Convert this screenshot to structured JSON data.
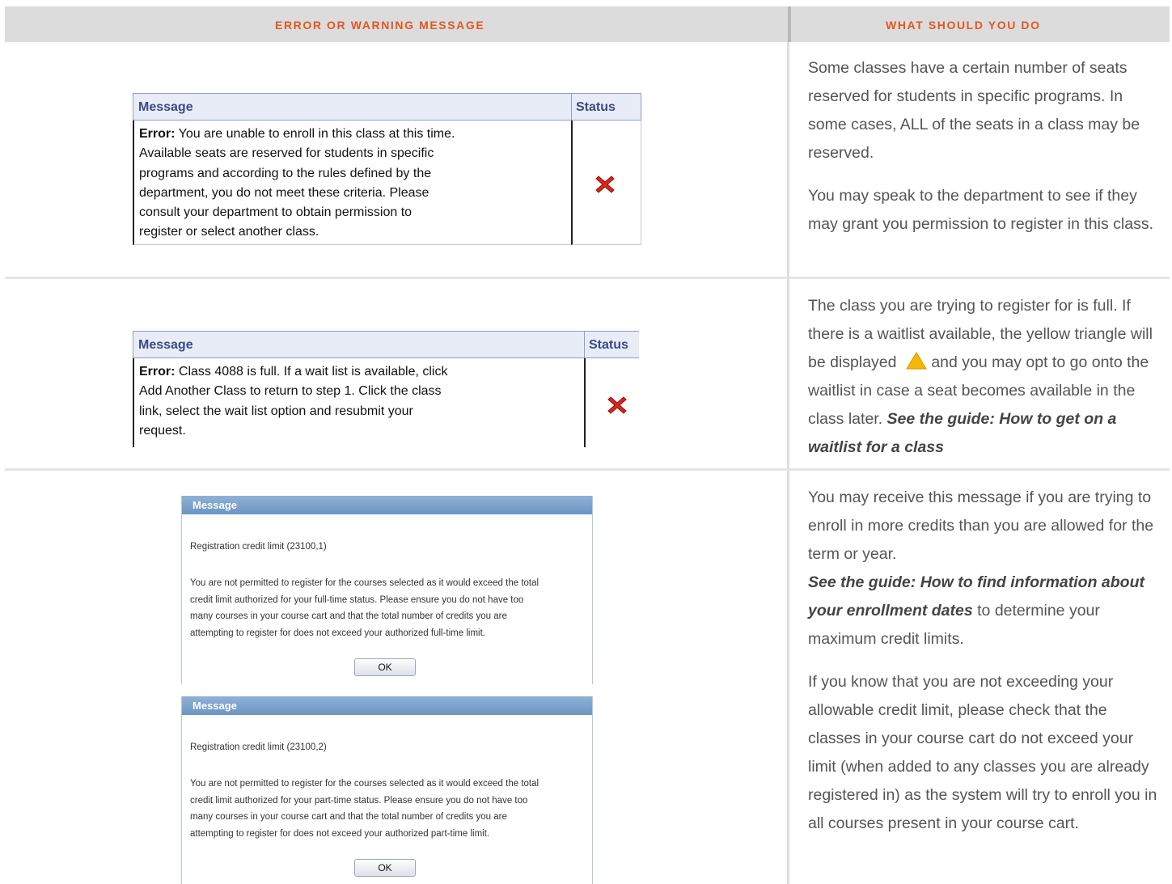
{
  "header": {
    "left_label": "ERROR OR WARNING MESSAGE",
    "right_label": "WHAT SHOULD YOU DO"
  },
  "rows": [
    {
      "table": {
        "col_message": "Message",
        "col_status": "Status",
        "error_label": "Error:",
        "error_lines": [
          " You are unable to enroll in this class at this time.",
          "Available seats are reserved for students in specific",
          "programs and according to the rules defined by the",
          "department, you do not meet these criteria. Please",
          "consult your department to obtain permission to",
          "register or select another class."
        ],
        "status_icon": "red-x-icon"
      },
      "advice": {
        "p1": "Some classes have a certain number of seats reserved for students in specific programs. In some cases, ALL of the seats in a class may be reserved.",
        "p2": "You may speak to the department to see if they may grant you permission to register in this class."
      }
    },
    {
      "table": {
        "col_message": "Message",
        "col_status": "Status",
        "error_label": "Error:",
        "error_lines": [
          " Class 4088 is full. If a wait list is available, click",
          "Add Another Class to return to step 1. Click the class",
          "link, select the wait list option and resubmit your",
          "request."
        ],
        "status_icon": "red-x-icon"
      },
      "advice": {
        "p1_a": "The class you are trying to register for is full. If there is a waitlist available, the yellow triangle will be displayed",
        "p1_b": " and you may opt to go onto the waitlist in case a seat becomes available in the class later. ",
        "p1_link": "See the guide: How to get on a waitlist for a class",
        "icon": "yellow-triangle-icon"
      }
    },
    {
      "dialogs": [
        {
          "title": "Message",
          "code": "Registration credit limit (23100,1)",
          "lines": [
            "You are not permitted to register for the courses selected as it would exceed the total",
            "credit limit authorized for your full-time status. Please ensure you do not have too",
            "many courses in your course  cart and that the total number of credits you are",
            "attempting to register for does not exceed your authorized full-time limit."
          ],
          "ok": "OK"
        },
        {
          "title": "Message",
          "code": "Registration credit limit (23100,2)",
          "lines": [
            "You are not permitted to register for the courses selected as it would exceed the total",
            "credit limit authorized for your part-time status. Please ensure you do not have too",
            "many courses in your course cart and that the total number of credits you are",
            "attempting to register for does not exceed your authorized part-time limit."
          ],
          "ok": "OK"
        }
      ],
      "advice": {
        "p1": "You may receive this message if you are trying to enroll in more credits than you are allowed for the term or year.",
        "p1_link": "See the guide: How to find information about your enrollment dates",
        "p1_tail": " to determine your maximum credit limits.",
        "p2": "If you know that you are not exceeding your allowable credit limit, please check that the classes in your course cart do not exceed your limit (when added to any classes you are already registered in) as the system will try to enroll you in all courses present in your course cart."
      }
    }
  ]
}
